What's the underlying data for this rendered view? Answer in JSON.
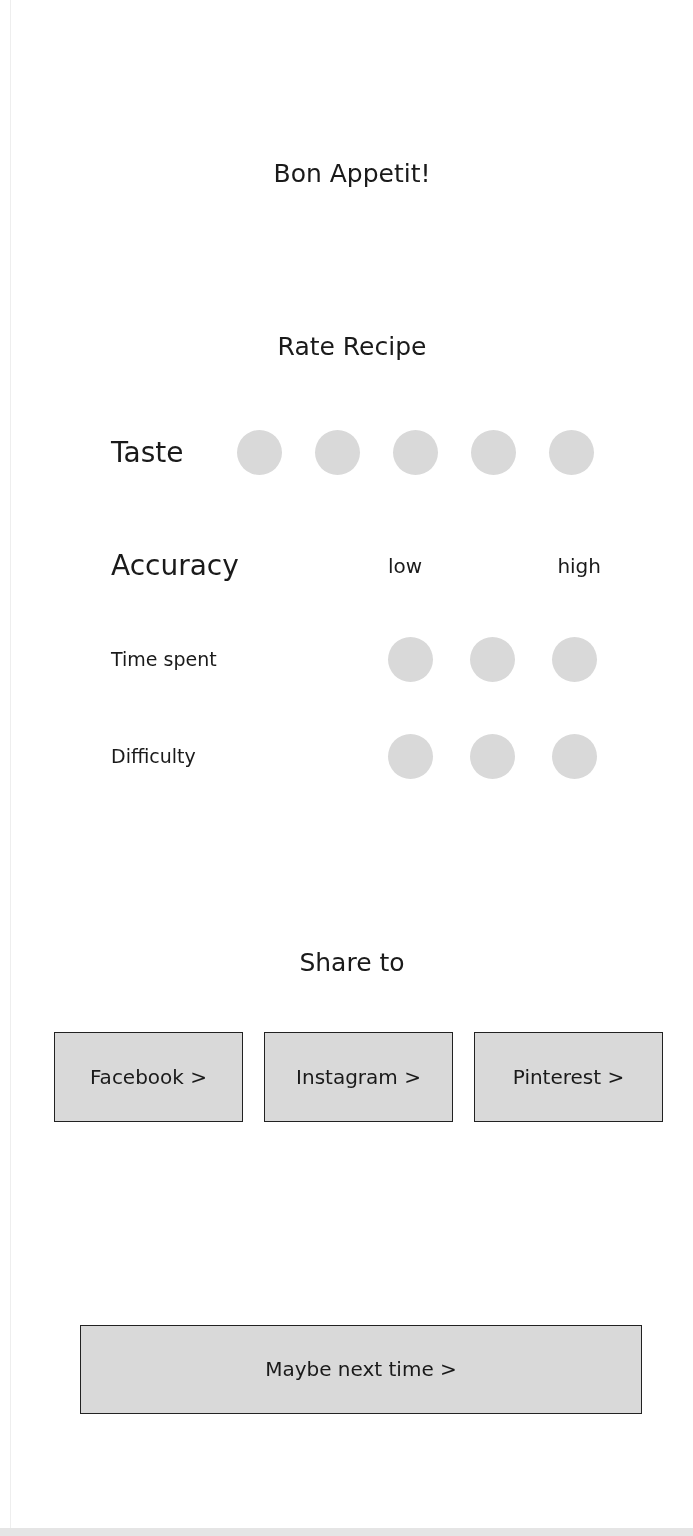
{
  "title": "Bon Appetit!",
  "rating": {
    "heading": "Rate Recipe",
    "taste": {
      "label": "Taste",
      "options": [
        {
          "selected": false
        },
        {
          "selected": false
        },
        {
          "selected": false
        },
        {
          "selected": false
        },
        {
          "selected": false
        }
      ]
    },
    "accuracy": {
      "label": "Accuracy",
      "scale_low": "low",
      "scale_high": "high"
    },
    "criteria": [
      {
        "label": "Time spent",
        "options": [
          {
            "selected": false
          },
          {
            "selected": false
          },
          {
            "selected": false
          }
        ]
      },
      {
        "label": "Difficulty",
        "options": [
          {
            "selected": false
          },
          {
            "selected": false
          },
          {
            "selected": false
          }
        ]
      }
    ]
  },
  "share": {
    "heading": "Share to",
    "buttons": [
      "Facebook >",
      "Instagram >",
      "Pinterest >"
    ]
  },
  "skip_button": "Maybe next time >"
}
